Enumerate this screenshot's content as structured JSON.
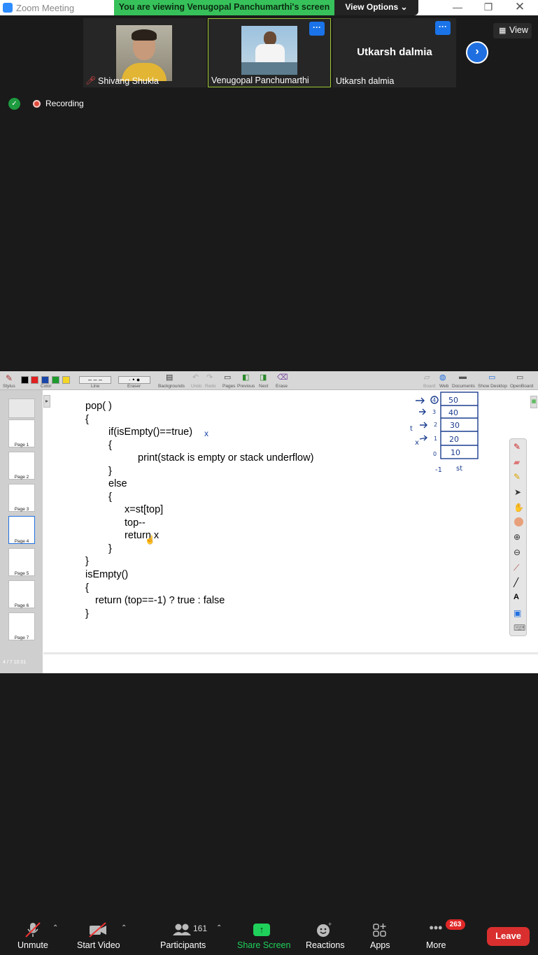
{
  "window": {
    "title": "Zoom Meeting",
    "banner": "You are viewing Venugopal Panchumarthi's screen",
    "view_options": "View Options"
  },
  "participants_strip": {
    "tiles": [
      {
        "name": "Shivang Shukla"
      },
      {
        "name": "Venugopal Panchumarthi",
        "more": "···"
      },
      {
        "name": "Utkarsh dalmia",
        "display": "Utkarsh dalmia",
        "more": "···"
      }
    ],
    "view_label": "View"
  },
  "status": {
    "recording": "Recording"
  },
  "whiteboard": {
    "toolbar": [
      "Stylus",
      "Color",
      "Line",
      "Eraser",
      "Backgrounds",
      "Undo",
      "Redo",
      "Pages",
      "Previous",
      "Next",
      "Erase",
      "Board",
      "Web",
      "Documents",
      "Show Desktop",
      "OpenBoard"
    ],
    "pages": [
      "Page 1",
      "Page 2",
      "Page 3",
      "Page 4",
      "Page 5",
      "Page 6",
      "Page 7"
    ],
    "page_info": "4 / 7  10:31",
    "code": [
      "pop( )",
      "{",
      "if(isEmpty()==true)",
      "{",
      "print(stack is empty or stack underflow)",
      "}",
      "else",
      "{",
      "x=st[top]",
      "top--",
      "return x",
      "}",
      "}",
      "isEmpty()",
      "{",
      "return (top==-1) ? true : false",
      "}"
    ],
    "stack": {
      "values": [
        "50",
        "40",
        "30",
        "20",
        "10"
      ],
      "indices": [
        "4",
        "3",
        "2",
        "1",
        "0"
      ],
      "below": "-1",
      "label": "st"
    }
  },
  "bottombar": {
    "unmute": "Unmute",
    "start_video": "Start Video",
    "participants": "Participants",
    "participants_count": "161",
    "share": "Share Screen",
    "reactions": "Reactions",
    "apps": "Apps",
    "more": "More",
    "more_badge": "263",
    "leave": "Leave"
  },
  "colors": {
    "banner": "#37c15a",
    "share_btn": "#1fd15b",
    "leave": "#d92f2f",
    "accent": "#1f6fe0"
  }
}
